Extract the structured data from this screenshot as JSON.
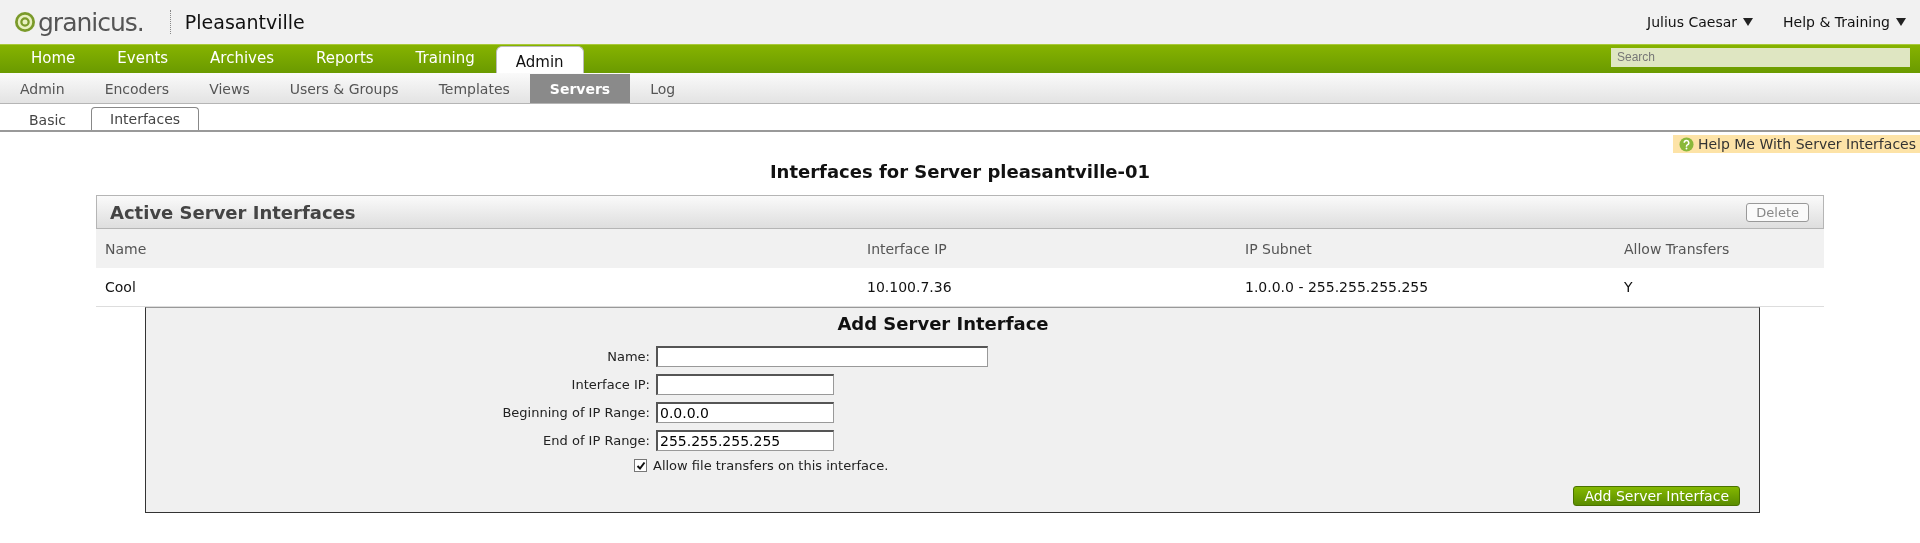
{
  "header": {
    "logo_text": "granicus.",
    "site_name": "Pleasantville",
    "user_menu": "Julius Caesar",
    "help_menu": "Help & Training"
  },
  "main_nav": [
    {
      "label": "Home",
      "selected": false
    },
    {
      "label": "Events",
      "selected": false
    },
    {
      "label": "Archives",
      "selected": false
    },
    {
      "label": "Reports",
      "selected": false
    },
    {
      "label": "Training",
      "selected": false
    },
    {
      "label": "Admin",
      "selected": true
    }
  ],
  "search": {
    "placeholder": "Search"
  },
  "sub_nav": [
    {
      "label": "Admin",
      "selected": false
    },
    {
      "label": "Encoders",
      "selected": false
    },
    {
      "label": "Views",
      "selected": false
    },
    {
      "label": "Users & Groups",
      "selected": false
    },
    {
      "label": "Templates",
      "selected": false
    },
    {
      "label": "Servers",
      "selected": true
    },
    {
      "label": "Log",
      "selected": false
    }
  ],
  "tabs": [
    {
      "label": "Basic",
      "selected": false
    },
    {
      "label": "Interfaces",
      "selected": true
    }
  ],
  "help_link": "Help Me With Server Interfaces",
  "page_title": "Interfaces for Server pleasantville-01",
  "panel": {
    "title": "Active Server Interfaces",
    "delete_button": "Delete",
    "columns": [
      "Name",
      "Interface IP",
      "IP Subnet",
      "Allow Transfers"
    ],
    "rows": [
      [
        "Cool",
        "10.100.7.36",
        "1.0.0.0 - 255.255.255.255",
        "Y"
      ]
    ]
  },
  "form": {
    "title": "Add Server Interface",
    "fields": [
      {
        "label": "Name:",
        "kind": "name"
      },
      {
        "label": "Interface IP:",
        "kind": "address"
      },
      {
        "label": "Beginning of IP Range:",
        "value": "0.0.0.0",
        "kind": "address"
      },
      {
        "label": "End of IP Range:",
        "value": "255.255.255.255",
        "kind": "address"
      }
    ],
    "checkbox": {
      "label": "Allow file transfers on this interface.",
      "checked": true
    },
    "submit": "Add Server Interface"
  }
}
